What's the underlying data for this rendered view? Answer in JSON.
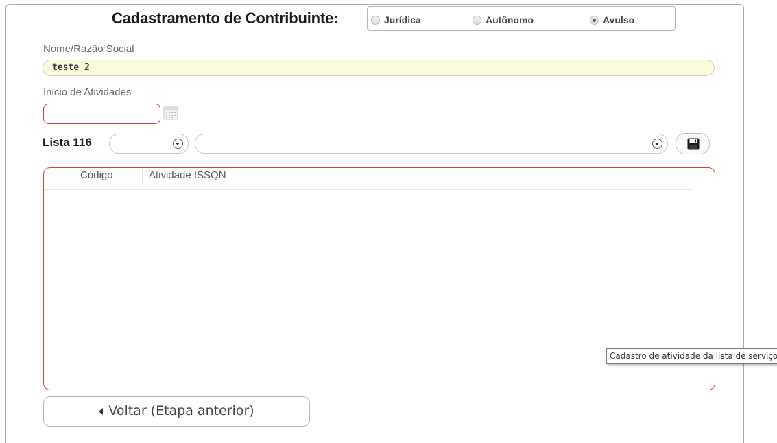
{
  "form": {
    "title": "Cadastramento de Contribuinte:",
    "person_types": [
      {
        "label": "Jurídica",
        "selected": false
      },
      {
        "label": "Autônomo",
        "selected": false
      },
      {
        "label": "Avulso",
        "selected": true
      }
    ],
    "name": {
      "label": "Nome/Razão Social",
      "value": "teste 2"
    },
    "start_date": {
      "label": "Inicio de Atividades",
      "value": ""
    }
  },
  "lista": {
    "label": "Lista 116",
    "code_select_value": "",
    "activity_select_value": ""
  },
  "grid": {
    "columns": [
      "Código",
      "Atividade ISSQN"
    ],
    "rows": []
  },
  "tooltip": {
    "text": "Cadastro de atividade da lista de serviços"
  },
  "nav": {
    "back_label": "Voltar (Etapa anterior)"
  },
  "colors": {
    "error_border": "#e03b3b",
    "input_highlight": "#fcfcdd"
  }
}
